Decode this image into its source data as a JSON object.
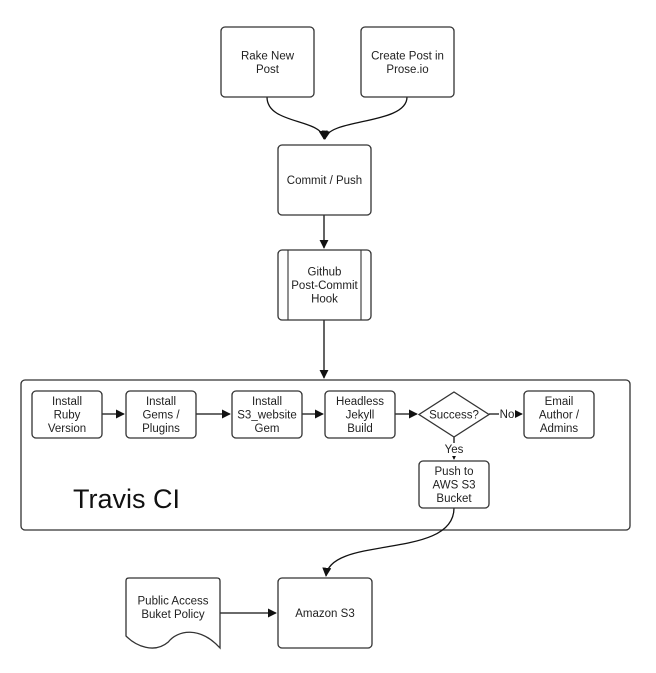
{
  "diagram": {
    "colors": {
      "stroke": "#333333",
      "fill": "#ffffff",
      "text": "#222222"
    },
    "container": {
      "title": "Travis CI"
    },
    "nodes": [
      {
        "id": "rake",
        "shape": "rounded-rect",
        "lines": [
          "Rake New",
          "Post"
        ]
      },
      {
        "id": "prose",
        "shape": "rounded-rect",
        "lines": [
          "Create Post in",
          "Prose.io"
        ]
      },
      {
        "id": "commit",
        "shape": "rounded-rect",
        "lines": [
          "Commit / Push"
        ]
      },
      {
        "id": "hook",
        "shape": "predefined-process",
        "lines": [
          "Github",
          "Post-Commit",
          "Hook"
        ]
      },
      {
        "id": "ruby",
        "shape": "rounded-rect",
        "lines": [
          "Install",
          "Ruby",
          "Version"
        ]
      },
      {
        "id": "gems",
        "shape": "rounded-rect",
        "lines": [
          "Install",
          "Gems /",
          "Plugins"
        ]
      },
      {
        "id": "s3gem",
        "shape": "rounded-rect",
        "lines": [
          "Install",
          "S3_website",
          "Gem"
        ]
      },
      {
        "id": "jekyll",
        "shape": "rounded-rect",
        "lines": [
          "Headless",
          "Jekyll",
          "Build"
        ]
      },
      {
        "id": "success",
        "shape": "diamond",
        "lines": [
          "Success?"
        ]
      },
      {
        "id": "email",
        "shape": "rounded-rect",
        "lines": [
          "Email",
          "Author /",
          "Admins"
        ]
      },
      {
        "id": "push",
        "shape": "rounded-rect",
        "lines": [
          "Push to",
          "AWS S3",
          "Bucket"
        ]
      },
      {
        "id": "policy",
        "shape": "document",
        "lines": [
          "Public Access",
          "Buket Policy"
        ]
      },
      {
        "id": "s3",
        "shape": "rounded-rect",
        "lines": [
          "Amazon S3"
        ]
      }
    ],
    "edges": [
      {
        "from": "rake",
        "to": "commit",
        "label": ""
      },
      {
        "from": "prose",
        "to": "commit",
        "label": ""
      },
      {
        "from": "commit",
        "to": "hook",
        "label": ""
      },
      {
        "from": "hook",
        "to": "container",
        "label": ""
      },
      {
        "from": "ruby",
        "to": "gems",
        "label": ""
      },
      {
        "from": "gems",
        "to": "s3gem",
        "label": ""
      },
      {
        "from": "s3gem",
        "to": "jekyll",
        "label": ""
      },
      {
        "from": "jekyll",
        "to": "success",
        "label": ""
      },
      {
        "from": "success",
        "to": "email",
        "label": "No"
      },
      {
        "from": "success",
        "to": "push",
        "label": "Yes"
      },
      {
        "from": "push",
        "to": "s3",
        "label": ""
      },
      {
        "from": "policy",
        "to": "s3",
        "label": ""
      }
    ]
  }
}
